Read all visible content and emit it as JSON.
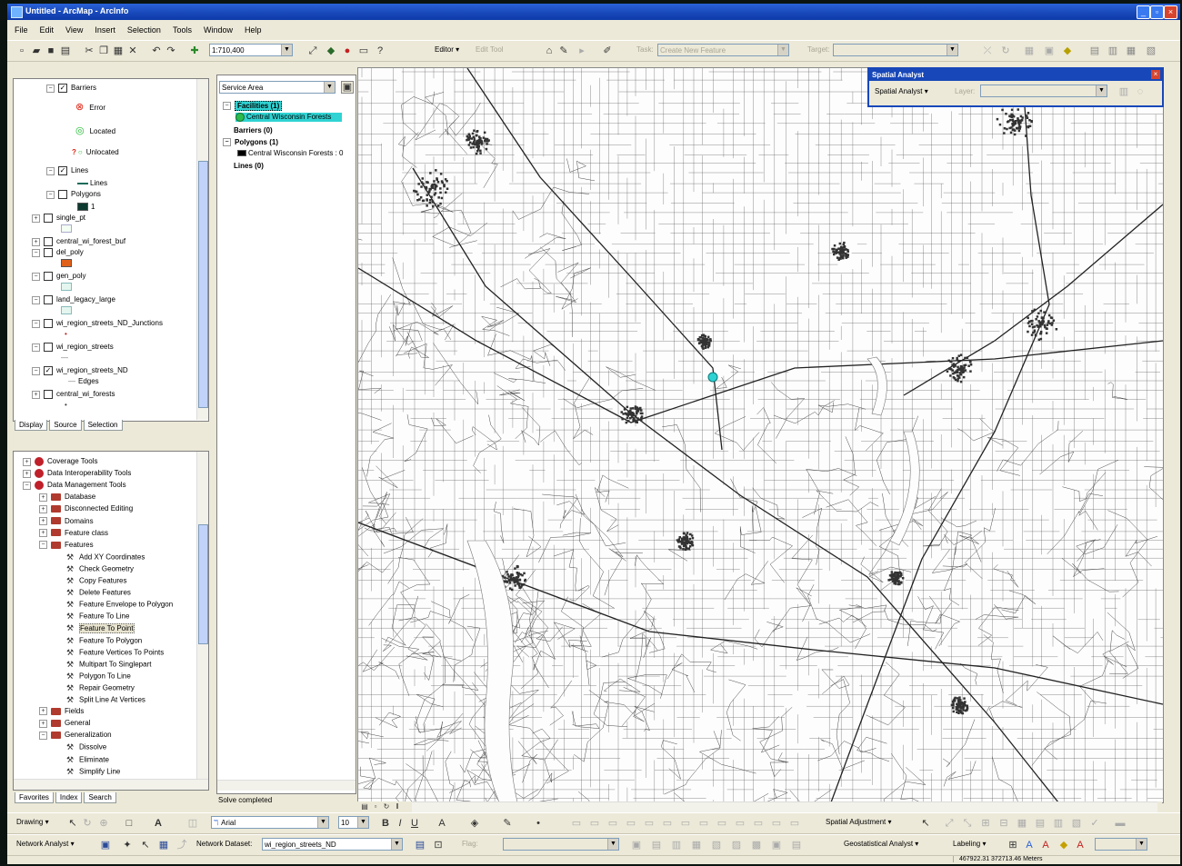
{
  "window": {
    "title": "Untitled - ArcMap - ArcInfo"
  },
  "menu": [
    "File",
    "Edit",
    "View",
    "Insert",
    "Selection",
    "Tools",
    "Window",
    "Help"
  ],
  "toolbar1": {
    "scale": "1:710,400",
    "editor_label": "Editor",
    "task_label": "Task:",
    "task_value": "Create New Feature",
    "target_label": "Target:"
  },
  "toc": {
    "tabs": [
      "Display",
      "Source",
      "Selection"
    ],
    "rows": [
      {
        "label": "Barriers",
        "checked": true
      },
      {
        "label": "Error"
      },
      {
        "label": "Located"
      },
      {
        "label": "Unlocated"
      },
      {
        "label": "Lines",
        "checked": true
      },
      {
        "label": "Lines"
      },
      {
        "label": "Polygons",
        "checked": false
      },
      {
        "label": "1"
      },
      {
        "label": "single_pt",
        "checked": false
      },
      {
        "label": "central_wi_forest_buf",
        "checked": false
      },
      {
        "label": "del_poly",
        "checked": false
      },
      {
        "label": "gen_poly",
        "checked": false
      },
      {
        "label": "land_legacy_large",
        "checked": false
      },
      {
        "label": "wi_region_streets_ND_Junctions",
        "checked": false
      },
      {
        "label": "wi_region_streets",
        "checked": false
      },
      {
        "label": "wi_region_streets_ND",
        "checked": true
      },
      {
        "label": "Edges"
      },
      {
        "label": "central_wi_forests",
        "checked": false
      }
    ]
  },
  "na_window": {
    "dropdown": "Service Area",
    "items": [
      {
        "label": "Facilities (1)",
        "bold": true,
        "selected": true
      },
      {
        "label": "Central Wisconsin Forests",
        "selected": true
      },
      {
        "label": "Barriers (0)",
        "bold": true
      },
      {
        "label": "Polygons (1)",
        "bold": true
      },
      {
        "label": "Central Wisconsin Forests : 0"
      },
      {
        "label": "Lines (0)",
        "bold": true
      }
    ],
    "status": "Solve completed"
  },
  "arctoolbox": {
    "tabs": [
      "Favorites",
      "Index",
      "Search"
    ],
    "rows": [
      {
        "label": "Coverage Tools",
        "type": "toolbox"
      },
      {
        "label": "Data Interoperability Tools",
        "type": "toolbox"
      },
      {
        "label": "Data Management Tools",
        "type": "toolbox"
      },
      {
        "label": "Database",
        "type": "folder"
      },
      {
        "label": "Disconnected Editing",
        "type": "folder"
      },
      {
        "label": "Domains",
        "type": "folder"
      },
      {
        "label": "Feature class",
        "type": "folder"
      },
      {
        "label": "Features",
        "type": "folder"
      },
      {
        "label": "Add XY Coordinates",
        "type": "tool"
      },
      {
        "label": "Check Geometry",
        "type": "tool"
      },
      {
        "label": "Copy Features",
        "type": "tool"
      },
      {
        "label": "Delete Features",
        "type": "tool"
      },
      {
        "label": "Feature Envelope to Polygon",
        "type": "tool"
      },
      {
        "label": "Feature To Line",
        "type": "tool"
      },
      {
        "label": "Feature To Point",
        "type": "tool"
      },
      {
        "label": "Feature To Polygon",
        "type": "tool"
      },
      {
        "label": "Feature Vertices To Points",
        "type": "tool"
      },
      {
        "label": "Multipart To Singlepart",
        "type": "tool"
      },
      {
        "label": "Polygon To Line",
        "type": "tool"
      },
      {
        "label": "Repair Geometry",
        "type": "tool"
      },
      {
        "label": "Split Line At Vertices",
        "type": "tool"
      },
      {
        "label": "Fields",
        "type": "folder"
      },
      {
        "label": "General",
        "type": "folder"
      },
      {
        "label": "Generalization",
        "type": "folder"
      },
      {
        "label": "Dissolve",
        "type": "tool"
      },
      {
        "label": "Eliminate",
        "type": "tool"
      },
      {
        "label": "Simplify Line",
        "type": "tool"
      }
    ]
  },
  "spatial_analyst": {
    "title": "Spatial Analyst",
    "menu_label": "Spatial Analyst",
    "layer_label": "Layer:"
  },
  "toolbar_bottom1": {
    "drawing_label": "Drawing",
    "font": "Arial",
    "font_size": "10",
    "spatial_adjustment_label": "Spatial Adjustment"
  },
  "toolbar_bottom2": {
    "network_analyst_label": "Network Analyst",
    "network_dataset_label": "Network Dataset:",
    "network_dataset_value": "wi_region_streets_ND",
    "geostat_label": "Geostatistical Analyst",
    "labeling_label": "Labeling"
  },
  "status": {
    "coords": "467922.31  372713.46 Meters"
  },
  "colors": {
    "title_blue": "#1747b8",
    "facility_cyan": "#2fd3d3",
    "panel_bg": "#ece9d8"
  }
}
